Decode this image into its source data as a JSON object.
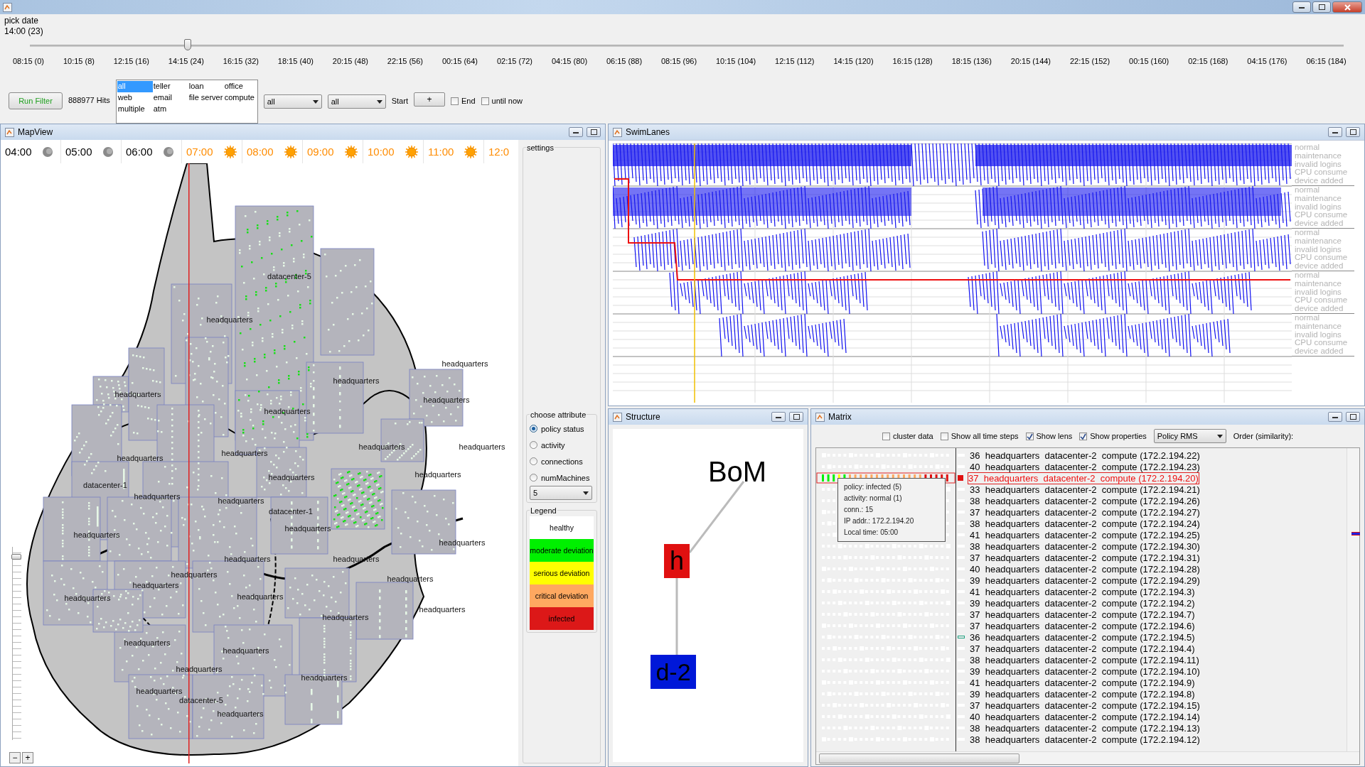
{
  "date_picker": {
    "label": "pick date",
    "value": "14:00 (23)",
    "level": 0.12,
    "ticks": [
      "08:15 (0)",
      "10:15 (8)",
      "12:15 (16)",
      "14:15 (24)",
      "16:15 (32)",
      "18:15 (40)",
      "20:15 (48)",
      "22:15 (56)",
      "00:15 (64)",
      "02:15 (72)",
      "04:15 (80)",
      "06:15 (88)",
      "08:15 (96)",
      "10:15 (104)",
      "12:15 (112)",
      "14:15 (120)",
      "16:15 (128)",
      "18:15 (136)",
      "20:15 (144)",
      "22:15 (152)",
      "00:15 (160)",
      "02:15 (168)",
      "04:15 (176)",
      "06:15 (184)"
    ]
  },
  "filter": {
    "run_button": "Run Filter",
    "hits": "888977 Hits",
    "types": [
      {
        "label": "all",
        "selected": true
      },
      {
        "label": "teller",
        "selected": false
      },
      {
        "label": "loan",
        "selected": false
      },
      {
        "label": "office",
        "selected": false
      },
      {
        "label": "web",
        "selected": false
      },
      {
        "label": "email",
        "selected": false
      },
      {
        "label": "file server",
        "selected": false
      },
      {
        "label": "compute",
        "selected": false
      },
      {
        "label": "multiple",
        "selected": false
      },
      {
        "label": "atm",
        "selected": false
      }
    ],
    "dropdowns": [
      "all",
      "all"
    ],
    "start_label": "Start",
    "add_button": "+",
    "checkboxes": [
      {
        "label": "End",
        "checked": false
      },
      {
        "label": "until now",
        "checked": false
      }
    ]
  },
  "map_view": {
    "title": "MapView",
    "hours": [
      {
        "label": "04:00",
        "kind": "night"
      },
      {
        "label": "05:00",
        "kind": "night"
      },
      {
        "label": "06:00",
        "kind": "night"
      },
      {
        "label": "07:00",
        "kind": "day"
      },
      {
        "label": "08:00",
        "kind": "day"
      },
      {
        "label": "09:00",
        "kind": "day"
      },
      {
        "label": "10:00",
        "kind": "day"
      },
      {
        "label": "11:00",
        "kind": "day"
      },
      {
        "label": "12:0",
        "kind": "day"
      }
    ],
    "labels": [
      "datacenter-5",
      "headquarters",
      "headquarters",
      "headquarters",
      "headquarters",
      "headquarters",
      "headquarters",
      "headquarters",
      "headquarters",
      "headquarters",
      "headquarters",
      "headquarters",
      "headquarters",
      "datacenter-1",
      "headquarters",
      "headquarters",
      "datacenter-1",
      "headquarters",
      "headquarters",
      "headquarters",
      "headquarters",
      "headquarters",
      "headquarters",
      "headquarters",
      "headquarters",
      "headquarters",
      "headquarters",
      "headquarters",
      "headquarters",
      "headquarters",
      "headquarters",
      "headquarters",
      "headquarters",
      "headquarters",
      "datacenter-5",
      "headquarters"
    ],
    "zoom_buttons": [
      "−",
      "+"
    ],
    "zoom_slider": {
      "level": 0.95
    },
    "settings": {
      "title": "settings",
      "attribute_title": "choose attribute",
      "attributes": [
        {
          "label": "policy status",
          "selected": true
        },
        {
          "label": "activity",
          "selected": false
        },
        {
          "label": "connections",
          "selected": false
        },
        {
          "label": "numMachines",
          "selected": false
        }
      ],
      "count_select": "5",
      "legend_title": "Legend",
      "legend": [
        {
          "label": "healthy",
          "color": "#ffffff"
        },
        {
          "label": "moderate deviation",
          "color": "#00f000"
        },
        {
          "label": "serious deviation",
          "color": "#ffff00"
        },
        {
          "label": "critical deviation",
          "color": "#ffa860"
        },
        {
          "label": "infected",
          "color": "#dc1818"
        }
      ]
    }
  },
  "swim_lanes": {
    "title": "SwimLanes",
    "groups": [
      {
        "labels": [
          "normal",
          "maintenance",
          "invalid logins",
          "CPU consume",
          "device added"
        ]
      },
      {
        "labels": [
          "normal",
          "maintenance",
          "invalid logins",
          "CPU consume",
          "device added"
        ]
      },
      {
        "labels": [
          "normal",
          "maintenance",
          "invalid logins",
          "CPU consume",
          "device added"
        ]
      },
      {
        "labels": [
          "normal",
          "maintenance",
          "invalid logins",
          "CPU consume",
          "device added"
        ]
      },
      {
        "labels": [
          "normal",
          "maintenance",
          "invalid logins",
          "CPU consume",
          "device added"
        ]
      }
    ]
  },
  "structure": {
    "title": "Structure",
    "nodes": [
      {
        "label": "BoM",
        "kind": "root"
      },
      {
        "label": "h",
        "kind": "site",
        "color": "#e01010"
      },
      {
        "label": "d-2",
        "kind": "datacenter",
        "color": "#0018d8"
      }
    ]
  },
  "matrix": {
    "title": "Matrix",
    "options": [
      {
        "label": "cluster data",
        "checked": false
      },
      {
        "label": "Show all time steps",
        "checked": false
      },
      {
        "label": "Show lens",
        "checked": true
      },
      {
        "label": "Show properties",
        "checked": true
      }
    ],
    "measure_select": "Policy RMS",
    "order_label": "Order (similarity):",
    "rows": [
      {
        "count": "36",
        "location": "headquarters",
        "datacenter": "datacenter-2",
        "machine": "compute (172.2.194.22)",
        "selected": false,
        "flagged": false
      },
      {
        "count": "40",
        "location": "headquarters",
        "datacenter": "datacenter-2",
        "machine": "compute (172.2.194.23)",
        "selected": false,
        "flagged": false
      },
      {
        "count": "37",
        "location": "headquarters",
        "datacenter": "datacenter-2",
        "machine": "compute (172.2.194.20)",
        "selected": true,
        "flagged": false
      },
      {
        "count": "33",
        "location": "headquarters",
        "datacenter": "datacenter-2",
        "machine": "compute (172.2.194.21)",
        "selected": false,
        "flagged": false
      },
      {
        "count": "38",
        "location": "headquarters",
        "datacenter": "datacenter-2",
        "machine": "compute (172.2.194.26)",
        "selected": false,
        "flagged": false
      },
      {
        "count": "37",
        "location": "headquarters",
        "datacenter": "datacenter-2",
        "machine": "compute (172.2.194.27)",
        "selected": false,
        "flagged": false
      },
      {
        "count": "38",
        "location": "headquarters",
        "datacenter": "datacenter-2",
        "machine": "compute (172.2.194.24)",
        "selected": false,
        "flagged": false
      },
      {
        "count": "41",
        "location": "headquarters",
        "datacenter": "datacenter-2",
        "machine": "compute (172.2.194.25)",
        "selected": false,
        "flagged": false
      },
      {
        "count": "38",
        "location": "headquarters",
        "datacenter": "datacenter-2",
        "machine": "compute (172.2.194.30)",
        "selected": false,
        "flagged": false
      },
      {
        "count": "37",
        "location": "headquarters",
        "datacenter": "datacenter-2",
        "machine": "compute (172.2.194.31)",
        "selected": false,
        "flagged": false
      },
      {
        "count": "40",
        "location": "headquarters",
        "datacenter": "datacenter-2",
        "machine": "compute (172.2.194.28)",
        "selected": false,
        "flagged": false
      },
      {
        "count": "39",
        "location": "headquarters",
        "datacenter": "datacenter-2",
        "machine": "compute (172.2.194.29)",
        "selected": false,
        "flagged": false
      },
      {
        "count": "41",
        "location": "headquarters",
        "datacenter": "datacenter-2",
        "machine": "compute (172.2.194.3)",
        "selected": false,
        "flagged": false
      },
      {
        "count": "39",
        "location": "headquarters",
        "datacenter": "datacenter-2",
        "machine": "compute (172.2.194.2)",
        "selected": false,
        "flagged": false
      },
      {
        "count": "37",
        "location": "headquarters",
        "datacenter": "datacenter-2",
        "machine": "compute (172.2.194.7)",
        "selected": false,
        "flagged": false
      },
      {
        "count": "37",
        "location": "headquarters",
        "datacenter": "datacenter-2",
        "machine": "compute (172.2.194.6)",
        "selected": false,
        "flagged": false
      },
      {
        "count": "36",
        "location": "headquarters",
        "datacenter": "datacenter-2",
        "machine": "compute (172.2.194.5)",
        "selected": false,
        "flagged": true
      },
      {
        "count": "37",
        "location": "headquarters",
        "datacenter": "datacenter-2",
        "machine": "compute (172.2.194.4)",
        "selected": false,
        "flagged": false
      },
      {
        "count": "38",
        "location": "headquarters",
        "datacenter": "datacenter-2",
        "machine": "compute (172.2.194.11)",
        "selected": false,
        "flagged": false
      },
      {
        "count": "39",
        "location": "headquarters",
        "datacenter": "datacenter-2",
        "machine": "compute (172.2.194.10)",
        "selected": false,
        "flagged": false
      },
      {
        "count": "41",
        "location": "headquarters",
        "datacenter": "datacenter-2",
        "machine": "compute (172.2.194.9)",
        "selected": false,
        "flagged": false
      },
      {
        "count": "39",
        "location": "headquarters",
        "datacenter": "datacenter-2",
        "machine": "compute (172.2.194.8)",
        "selected": false,
        "flagged": false
      },
      {
        "count": "37",
        "location": "headquarters",
        "datacenter": "datacenter-2",
        "machine": "compute (172.2.194.15)",
        "selected": false,
        "flagged": false
      },
      {
        "count": "40",
        "location": "headquarters",
        "datacenter": "datacenter-2",
        "machine": "compute (172.2.194.14)",
        "selected": false,
        "flagged": false
      },
      {
        "count": "38",
        "location": "headquarters",
        "datacenter": "datacenter-2",
        "machine": "compute (172.2.194.13)",
        "selected": false,
        "flagged": false
      },
      {
        "count": "38",
        "location": "headquarters",
        "datacenter": "datacenter-2",
        "machine": "compute (172.2.194.12)",
        "selected": false,
        "flagged": false
      }
    ],
    "tooltip": [
      "policy: infected (5)",
      "activity: normal (1)",
      "conn.: 15",
      "IP addr.: 172.2.194.20",
      "Local time: 05:00"
    ]
  }
}
